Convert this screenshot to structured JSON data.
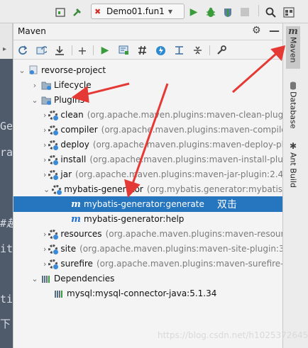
{
  "toolbar": {
    "run_config_label": "Demo01.fun1",
    "run_config_warning_icon": "error-cross-icon"
  },
  "editor_strip": {
    "lines": [
      "Ge",
      "ra",
      "#趣",
      "it",
      "ti",
      "下"
    ]
  },
  "maven_panel": {
    "title": "Maven",
    "tree": [
      {
        "label": "revorse-project",
        "desc": "",
        "icon": "maven-module-icon"
      },
      {
        "label": "Lifecycle",
        "desc": "",
        "icon": "folder-gear-icon"
      },
      {
        "label": "Plugins",
        "desc": "",
        "icon": "folder-gear-icon"
      },
      {
        "label": "clean",
        "desc": "(org.apache.maven.plugins:maven-clean-plugin",
        "icon": "plugin-gear-icon"
      },
      {
        "label": "compiler",
        "desc": "(org.apache.maven.plugins:maven-compiler",
        "icon": "plugin-gear-icon"
      },
      {
        "label": "deploy",
        "desc": "(org.apache.maven.plugins:maven-deploy-plu",
        "icon": "plugin-gear-icon"
      },
      {
        "label": "install",
        "desc": "(org.apache.maven.plugins:maven-install-plugi",
        "icon": "plugin-gear-icon"
      },
      {
        "label": "jar",
        "desc": "(org.apache.maven.plugins:maven-jar-plugin:2.4)",
        "icon": "plugin-gear-icon"
      },
      {
        "label": "mybatis-generator",
        "desc": "(org.mybatis.generator:mybatis-g",
        "icon": "plugin-gear-icon"
      },
      {
        "label": "mybatis-generator:generate",
        "desc": "",
        "icon": "maven-goal-icon"
      },
      {
        "label": "mybatis-generator:help",
        "desc": "",
        "icon": "maven-goal-icon"
      },
      {
        "label": "resources",
        "desc": "(org.apache.maven.plugins:maven-resourc",
        "icon": "plugin-gear-icon"
      },
      {
        "label": "site",
        "desc": "(org.apache.maven.plugins:maven-site-plugin:3.3",
        "icon": "plugin-gear-icon"
      },
      {
        "label": "surefire",
        "desc": "(org.apache.maven.plugins:maven-surefire-p",
        "icon": "plugin-gear-icon"
      },
      {
        "label": "Dependencies",
        "desc": "",
        "icon": "library-bars-icon"
      },
      {
        "label": "mysql:mysql-connector-java:5.1.34",
        "desc": "",
        "icon": "library-bars-icon"
      }
    ],
    "selected_annotation": "双击"
  },
  "right_strip": {
    "maven_tab": "Maven",
    "database_tab": "Database",
    "ant_tab": "Ant Build"
  },
  "watermark": "https://blog.csdn.net/h1025372645",
  "colors": {
    "selection": "#2675bf",
    "annotation_arrow": "#e53935",
    "run_green": "#3a9b3a"
  }
}
